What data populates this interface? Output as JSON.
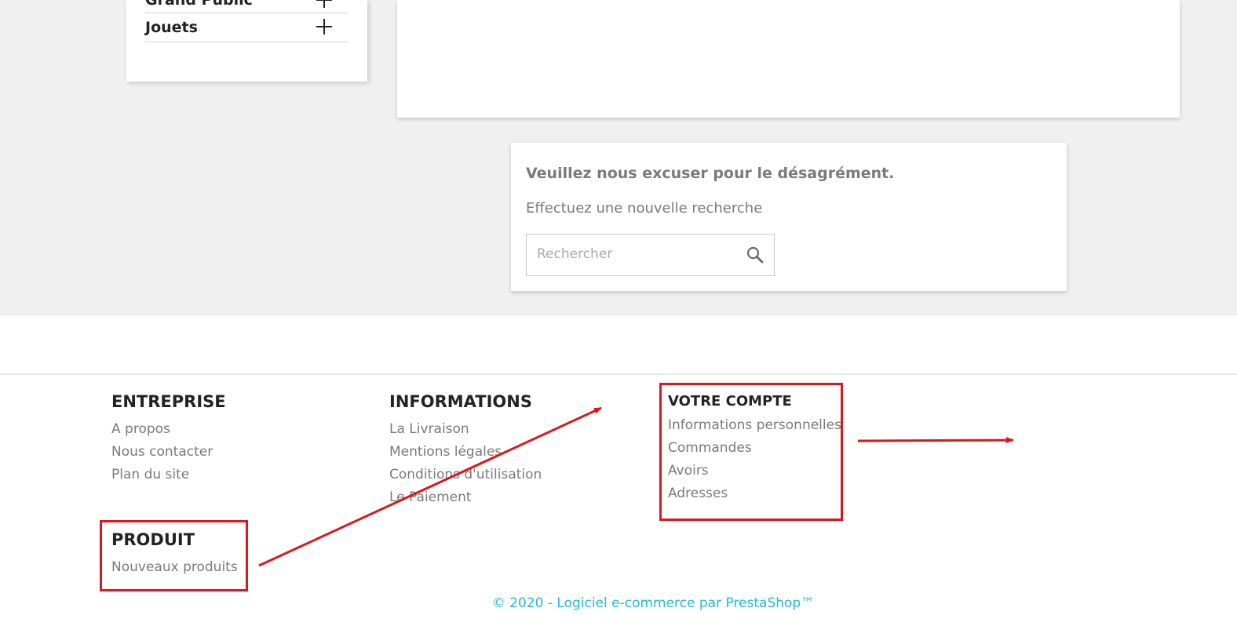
{
  "categories": [
    {
      "label": "Grand Public"
    },
    {
      "label": "Jouets"
    }
  ],
  "not_found": {
    "title": "Veuillez nous excuser pour le désagrément.",
    "subtitle": "Effectuez une nouvelle recherche",
    "search_placeholder": "Rechercher"
  },
  "footer": {
    "entreprise": {
      "title": "ENTREPRISE",
      "links": [
        "A propos",
        "Nous contacter",
        "Plan du site"
      ]
    },
    "produit": {
      "title": "PRODUIT",
      "links": [
        "Nouveaux produits"
      ]
    },
    "informations": {
      "title": "INFORMATIONS",
      "links": [
        "La Livraison",
        "Mentions légales",
        "Conditions d'utilisation",
        "Le Paiement"
      ]
    },
    "compte": {
      "title": "VOTRE COMPTE",
      "links": [
        "Informations personnelles",
        "Commandes",
        "Avoirs",
        "Adresses"
      ]
    },
    "copyright": "© 2020 - Logiciel e-commerce par PrestaShop™"
  },
  "colors": {
    "annotation": "#d9171f",
    "link": "#7a7a7a",
    "copyright": "#24b9d7"
  }
}
